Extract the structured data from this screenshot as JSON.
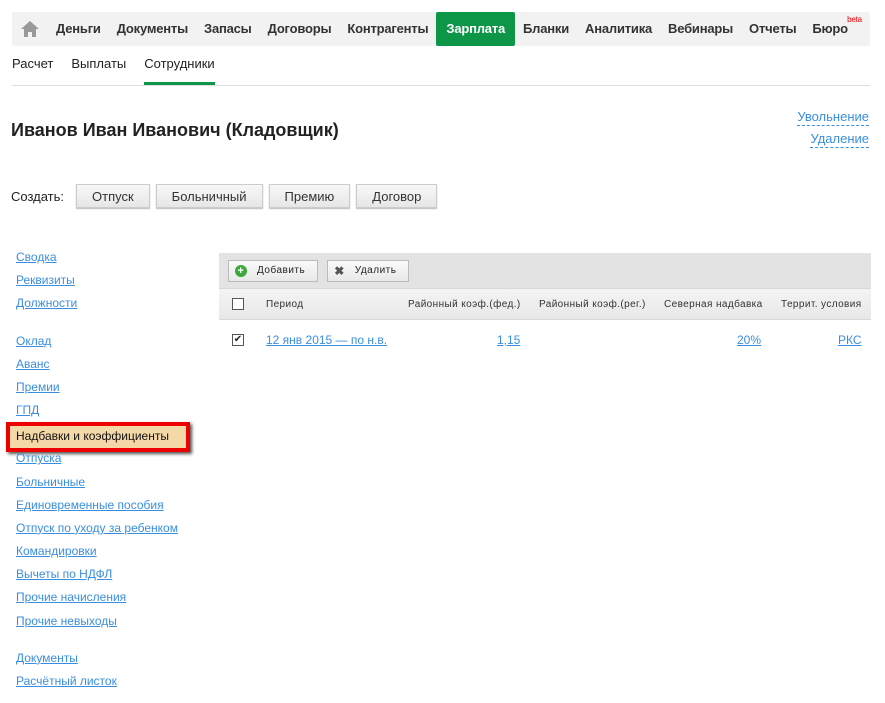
{
  "nav": {
    "items": [
      "Деньги",
      "Документы",
      "Запасы",
      "Договоры",
      "Контрагенты",
      "Зарплата",
      "Бланки",
      "Аналитика",
      "Вебинары",
      "Отчеты",
      "Бюро"
    ],
    "active": "Зарплата",
    "beta": "beta"
  },
  "subnav": {
    "items": [
      "Расчет",
      "Выплаты",
      "Сотрудники"
    ],
    "active": "Сотрудники"
  },
  "title": "Иванов Иван Иванович (Кладовщик)",
  "actions": {
    "dismiss": "Увольнение",
    "delete": "Удаление"
  },
  "create": {
    "label": "Создать:",
    "buttons": [
      "Отпуск",
      "Больничный",
      "Премию",
      "Договор"
    ]
  },
  "menu": {
    "group1": [
      "Сводка",
      "Реквизиты",
      "Должности"
    ],
    "group2": [
      "Оклад",
      "Аванс",
      "Премии",
      "ГПД",
      "Надбавки и коэффициенты",
      "Отпуска",
      "Больничные",
      "Единовременные пособия",
      "Отпуск по уходу за ребенком",
      "Командировки",
      "Вычеты по НДФЛ",
      "Прочие начисления",
      "Прочие невыходы"
    ],
    "group3": [
      "Документы",
      "Расчётный листок"
    ],
    "selected": "Надбавки и коэффициенты"
  },
  "toolbar": {
    "add": "Добавить",
    "remove": "Удалить"
  },
  "table": {
    "headers": [
      "Период",
      "Районный коэф.(фед.)",
      "Районный коэф.(рег.)",
      "Северная надбавка",
      "Террит. условия"
    ],
    "rows": [
      {
        "checked": true,
        "period": "12 янв 2015 — по н.в.",
        "fed": "1,15",
        "reg": "",
        "north": "20%",
        "terr": "РКС"
      }
    ]
  },
  "colors": {
    "accent": "#0e9648",
    "link": "#3a8ee0",
    "highlight": "#e00000"
  }
}
